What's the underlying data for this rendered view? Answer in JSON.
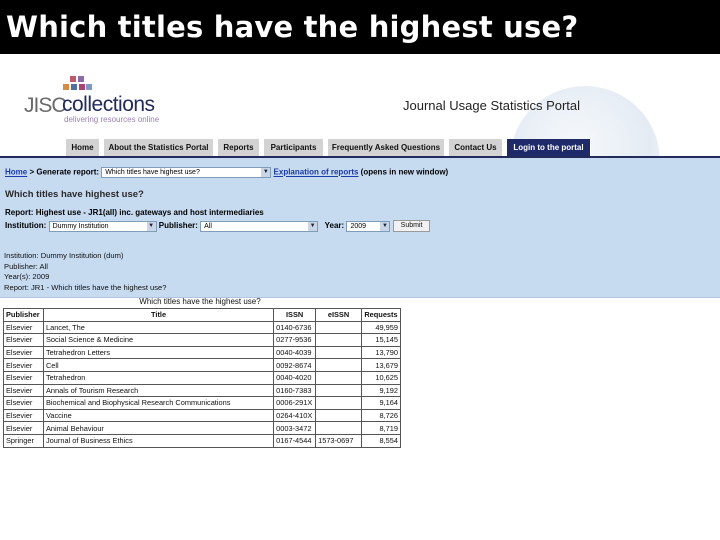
{
  "slide": {
    "title": "Which titles have the highest use?"
  },
  "logo": {
    "brand_left": "JISC",
    "brand_right": "collections",
    "tagline": "delivering resources online"
  },
  "portal": {
    "name": "Journal Usage Statistics Portal"
  },
  "nav": {
    "tabs": [
      {
        "label": "Home"
      },
      {
        "label": "About the Statistics Portal"
      },
      {
        "label": "Reports"
      },
      {
        "label": "Participants"
      },
      {
        "label": "Frequently Asked Questions"
      },
      {
        "label": "Contact Us"
      },
      {
        "label": "Login to the portal"
      }
    ]
  },
  "breadcrumb": {
    "home": "Home",
    "separator": ">",
    "generate_label": "Generate report:",
    "report_select": "Which titles have highest use?",
    "explanation_link": "Explanation of reports",
    "explanation_note": "(opens in new window)"
  },
  "page": {
    "question": "Which titles have highest use?"
  },
  "report": {
    "label": "Report:",
    "value": "Highest use - JR1(all) inc. gateways and host intermediaries"
  },
  "form": {
    "institution_label": "Institution:",
    "institution_value": "Dummy Institution",
    "publisher_label": "Publisher:",
    "publisher_value": "All",
    "year_label": "Year:",
    "year_value": "2009",
    "submit_label": "Submit"
  },
  "summary": {
    "institution": "Institution: Dummy Institution (dum)",
    "publisher": "Publisher: All",
    "years": "Year(s): 2009",
    "report": "Report: JR1 - Which titles have the highest use?"
  },
  "table": {
    "caption": "Which titles have the highest use?",
    "headers": [
      "Publisher",
      "Title",
      "ISSN",
      "eISSN",
      "Requests"
    ],
    "rows": [
      [
        "Elsevier",
        "Lancet, The",
        "0140-6736",
        "",
        "49,959"
      ],
      [
        "Elsevier",
        "Social Science & Medicine",
        "0277-9536",
        "",
        "15,145"
      ],
      [
        "Elsevier",
        "Tetrahedron Letters",
        "0040-4039",
        "",
        "13,790"
      ],
      [
        "Elsevier",
        "Cell",
        "0092-8674",
        "",
        "13,679"
      ],
      [
        "Elsevier",
        "Tetrahedron",
        "0040-4020",
        "",
        "10,625"
      ],
      [
        "Elsevier",
        "Annals of Tourism Research",
        "0160-7383",
        "",
        "9,192"
      ],
      [
        "Elsevier",
        "Biochemical and Biophysical Research Communications",
        "0006-291X",
        "",
        "9,164"
      ],
      [
        "Elsevier",
        "Vaccine",
        "0264-410X",
        "",
        "8,726"
      ],
      [
        "Elsevier",
        "Animal Behaviour",
        "0003-3472",
        "",
        "8,719"
      ],
      [
        "Springer",
        "Journal of Business Ethics",
        "0167-4544",
        "1573-0697",
        "8,554"
      ]
    ]
  },
  "colors": {
    "title_bar": "#000000",
    "nav_tab": "#d3d3d3",
    "login_tab": "#1f2a6b",
    "panel": "#c6daf0",
    "link": "#1a3aa8",
    "logo_squares": [
      "#c05a6a",
      "#8a6aa8",
      "#d98a3a",
      "#4e6fa8",
      "#b04070",
      "#7a9ac8"
    ]
  }
}
